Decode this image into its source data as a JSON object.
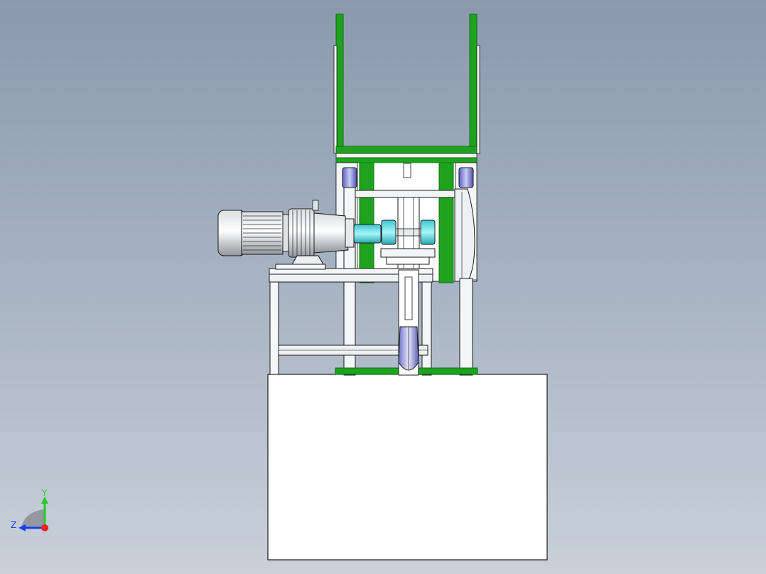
{
  "viewport": {
    "background_top": "#8b99ad",
    "background_bottom": "#c9d0da"
  },
  "colors": {
    "frame_green": "#1fa31f",
    "frame_green_dark": "#0d6e12",
    "cyan_part": "#5fe3e8",
    "steel": "#f2f4f5",
    "outline": "#1a1a1a",
    "roller_purple": "#7b7fd6"
  },
  "triad": {
    "y_label": "Y",
    "z_label": "Z",
    "y_color": "#22cc22",
    "z_color": "#1a3cff",
    "origin_color": "#ee2222"
  }
}
